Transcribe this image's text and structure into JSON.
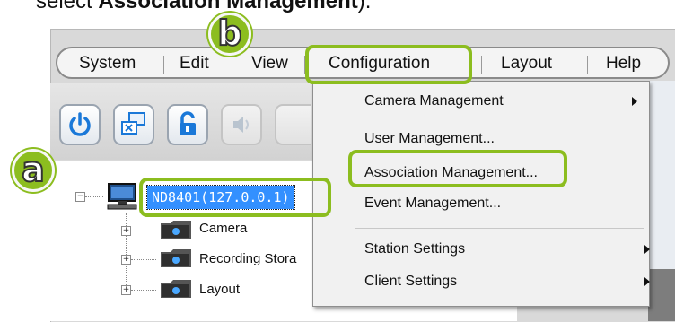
{
  "instruction": {
    "prefix": "select ",
    "bold": "Association Management",
    "suffix": ")."
  },
  "menubar": {
    "items": [
      {
        "label": "System"
      },
      {
        "label": "Edit"
      },
      {
        "label": "View"
      },
      {
        "label": "Configuration"
      },
      {
        "label": "Layout"
      },
      {
        "label": "Help"
      }
    ]
  },
  "toolbar": {
    "buttons": [
      {
        "icon": "power-icon"
      },
      {
        "icon": "monitor-switch-icon"
      },
      {
        "icon": "lock-icon"
      },
      {
        "icon": "speaker-icon"
      }
    ]
  },
  "tree": {
    "root": {
      "label": "ND8401(127.0.0.1)",
      "expander": "−"
    },
    "children": [
      {
        "label": "Camera",
        "expander": "+"
      },
      {
        "label": "Recording Stora",
        "expander": "+"
      },
      {
        "label": "Layout",
        "expander": "+"
      }
    ]
  },
  "dropdown": {
    "items": [
      {
        "label": "Camera Management",
        "submenu": true
      },
      {
        "label": "User Management...",
        "submenu": false
      },
      {
        "label": "Association Management...",
        "submenu": false
      },
      {
        "label": "Event Management...",
        "submenu": false
      },
      {
        "label": "Station Settings",
        "submenu": true
      },
      {
        "label": "Client Settings",
        "submenu": true
      }
    ]
  },
  "badges": {
    "a": "a",
    "b": "b"
  },
  "colors": {
    "highlight": "#8cbd1f",
    "selection": "#3390ff"
  }
}
